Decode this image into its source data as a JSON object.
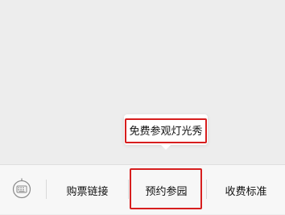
{
  "popup": {
    "item_label": "免费参观灯光秀"
  },
  "menu_bar": {
    "keyboard_icon": "keyboard-toggle-icon",
    "items": [
      {
        "label": "购票链接"
      },
      {
        "label": "预约参园"
      },
      {
        "label": "收费标准"
      }
    ]
  },
  "colors": {
    "highlight": "#d71e1e",
    "background": "#ededed",
    "menu_bar": "#f7f7f7",
    "text": "#111111"
  }
}
